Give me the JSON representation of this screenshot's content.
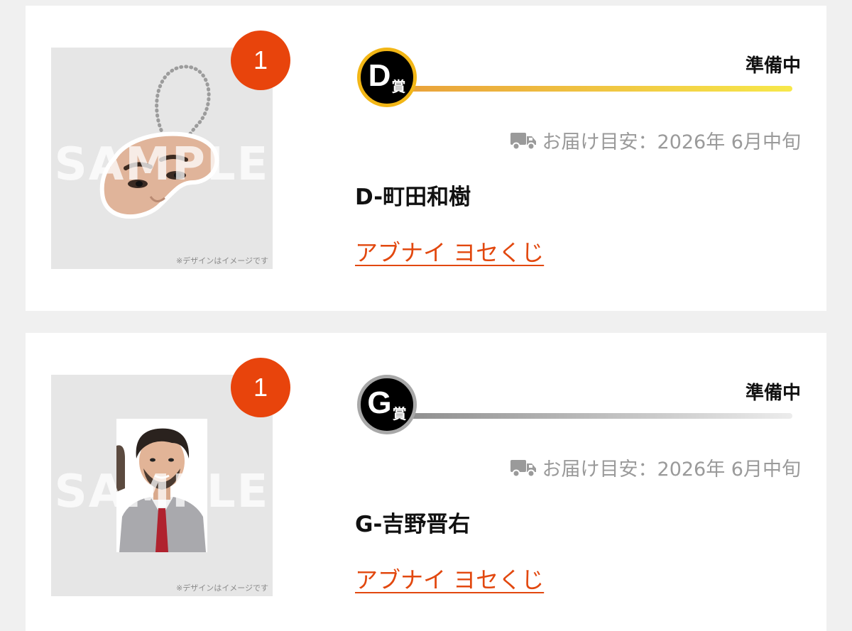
{
  "items": [
    {
      "quantity": "1",
      "prize_letter": "D",
      "prize_suffix": "賞",
      "status": "準備中",
      "delivery_label": "お届け目安：",
      "delivery_date": "2026年 6月中旬",
      "item_name": "D-町田和樹",
      "lottery_link": "アブナイ ヨセくじ",
      "watermark": "SAMPLE",
      "disclaimer": "※デザインはイメージです",
      "progress_color_start": "#e9a23a",
      "progress_color_end": "#f7e84a",
      "badge_ring_color": "#f2b616"
    },
    {
      "quantity": "1",
      "prize_letter": "G",
      "prize_suffix": "賞",
      "status": "準備中",
      "delivery_label": "お届け目安：",
      "delivery_date": "2026年 6月中旬",
      "item_name": "G-吉野晋右",
      "lottery_link": "アブナイ ヨセくじ",
      "watermark": "SAMPLE",
      "disclaimer": "※デザインはイメージです",
      "progress_color_start": "#8f8f8f",
      "progress_color_end": "#ececec",
      "badge_ring_color": "#a8a8a8"
    }
  ],
  "theme": {
    "accent": "#e8440c",
    "link_color": "#e2480f",
    "text_muted": "#9a9a9a"
  },
  "icons": {
    "truck": "truck-icon"
  }
}
